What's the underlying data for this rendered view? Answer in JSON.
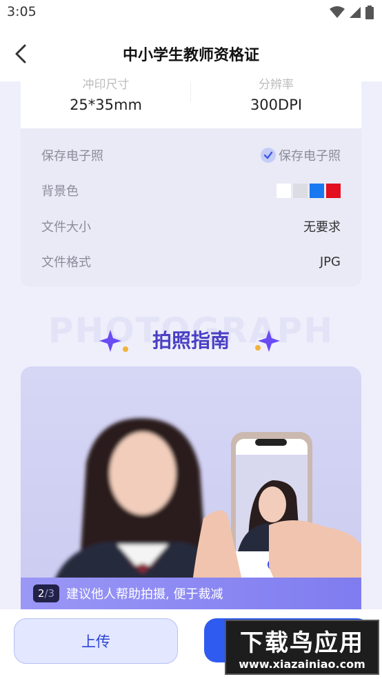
{
  "status_bar": {
    "time": "3:05"
  },
  "header": {
    "title": "中小学生教师资格证"
  },
  "spec": {
    "size_label": "冲印尺寸",
    "size_value": "25*35mm",
    "dpi_label": "分辨率",
    "dpi_value": "300DPI"
  },
  "info": {
    "rows": [
      {
        "key": "保存电子照",
        "value": "保存电子照"
      },
      {
        "key": "背景色"
      },
      {
        "key": "文件大小",
        "value": "无要求"
      },
      {
        "key": "文件格式",
        "value": "JPG"
      }
    ],
    "swatches": [
      "#ffffff",
      "#dcdde2",
      "#1a78f0",
      "#e21020"
    ]
  },
  "guide": {
    "bg_text": "PHOTOGRAPH",
    "title": "拍照指南",
    "page_current": "2",
    "page_total": "/3",
    "caption": "建议他人帮助拍摄, 便于裁减"
  },
  "buttons": {
    "upload": "上传"
  },
  "watermark": {
    "main": "下载鸟应用",
    "url": "www.xiazainiao.com"
  },
  "colors": {
    "accent": "#2f5bf0",
    "title_purple": "#4a3fc3",
    "caption_bar": "#8a87f3"
  }
}
